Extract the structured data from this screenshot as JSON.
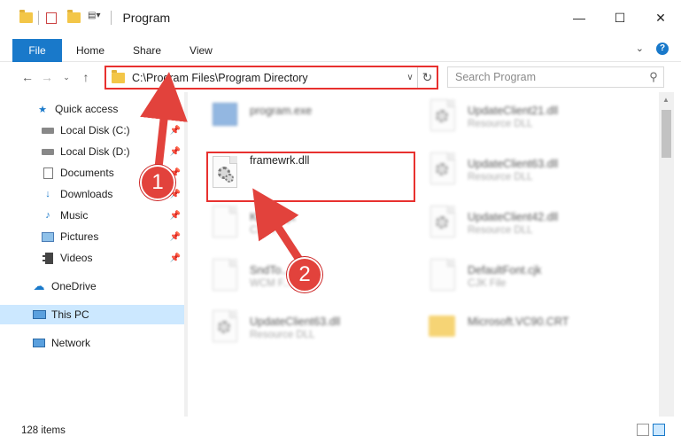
{
  "window": {
    "title": "Program",
    "minimize": "—",
    "maximize": "☐",
    "close": "✕"
  },
  "ribbon": {
    "tabs": [
      "File",
      "Home",
      "Share",
      "View"
    ],
    "expand": "⌄",
    "help": "?"
  },
  "address": {
    "path": "C:\\Program Files\\Program Directory",
    "search_placeholder": "Search Program"
  },
  "sidebar": {
    "items": [
      {
        "label": "Quick access",
        "icon": "star-icon",
        "pinned": false
      },
      {
        "label": "Local Disk (C:)",
        "icon": "drive-icon",
        "pinned": true
      },
      {
        "label": "Local Disk (D:)",
        "icon": "drive-icon",
        "pinned": true
      },
      {
        "label": "Documents",
        "icon": "documents-icon",
        "pinned": true
      },
      {
        "label": "Downloads",
        "icon": "download-icon",
        "pinned": true
      },
      {
        "label": "Music",
        "icon": "music-icon",
        "pinned": true
      },
      {
        "label": "Pictures",
        "icon": "pictures-icon",
        "pinned": true
      },
      {
        "label": "Videos",
        "icon": "videos-icon",
        "pinned": true
      },
      {
        "label": "OneDrive",
        "icon": "cloud-icon",
        "pinned": false
      },
      {
        "label": "This PC",
        "icon": "computer-icon",
        "pinned": false
      },
      {
        "label": "Network",
        "icon": "network-icon",
        "pinned": false
      }
    ]
  },
  "files": [
    {
      "name": "program.exe",
      "type": "",
      "icon": "exe-icon"
    },
    {
      "name": "UpdateClient21.dll",
      "type": "Resource DLL",
      "icon": "dll-icon"
    },
    {
      "name": "framewrk.dll",
      "type": "",
      "icon": "dll-icon"
    },
    {
      "name": "UpdateClient63.dll",
      "type": "Resource DLL",
      "icon": "dll-icon"
    },
    {
      "name": "Ko...n.cjk",
      "type": "CJK F...",
      "icon": "file-icon"
    },
    {
      "name": "UpdateClient42.dll",
      "type": "Resource DLL",
      "icon": "dll-icon"
    },
    {
      "name": "SndTo...cm",
      "type": "WCM F...",
      "icon": "file-icon"
    },
    {
      "name": "DefaultFont.cjk",
      "type": "CJK File",
      "icon": "file-icon"
    },
    {
      "name": "UpdateClient63.dll",
      "type": "Resource DLL",
      "icon": "dll-icon"
    },
    {
      "name": "Microsoft.VC90.CRT",
      "type": "",
      "icon": "folder-icon"
    }
  ],
  "status": {
    "item_count": "128 items"
  },
  "callouts": [
    "1",
    "2"
  ],
  "colors": {
    "accent": "#1979ca",
    "highlight": "#e8312f",
    "selection": "#cce8ff"
  }
}
